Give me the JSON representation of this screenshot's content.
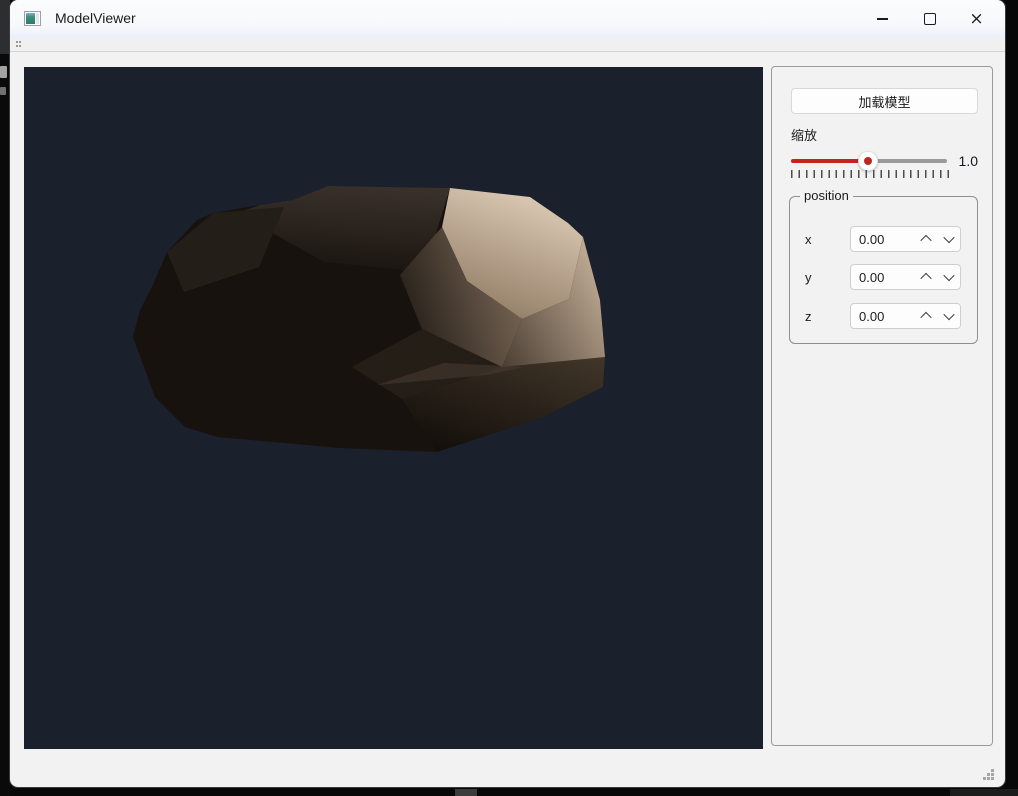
{
  "window": {
    "title": "ModelViewer",
    "icons": {
      "app": "model-viewer-logo",
      "minimize": "minimize-line",
      "maximize": "maximize-square",
      "close": "×",
      "toolbar_grip": "drag-handle-dots",
      "resize_grip": "size-grip-dots"
    }
  },
  "panel": {
    "load_button_label": "加载模型",
    "scale": {
      "label": "缩放",
      "value": "1.0",
      "percent": 49
    },
    "position_group": {
      "title": "position",
      "rows": [
        {
          "label": "x",
          "value": "0.00"
        },
        {
          "label": "y",
          "value": "0.00"
        },
        {
          "label": "z",
          "value": "0.00"
        }
      ]
    }
  },
  "viewport": {
    "content": "low-poly rock model",
    "background": "#1a202c"
  },
  "colors": {
    "accent_red": "#c2251d",
    "titlebar_tint": "#e9effb",
    "window_bg": "#f2f2f2",
    "rock_light": "#dccab4",
    "rock_dark": "#17120e"
  }
}
